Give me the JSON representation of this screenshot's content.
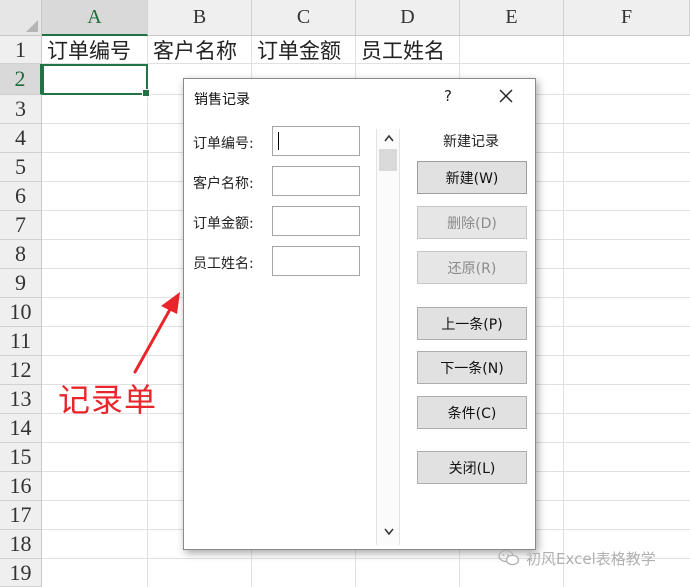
{
  "columns": [
    "A",
    "B",
    "C",
    "D",
    "E",
    "F"
  ],
  "rows": [
    "1",
    "2",
    "3",
    "4",
    "5",
    "6",
    "7",
    "8",
    "9",
    "10",
    "11",
    "12",
    "13",
    "14",
    "15",
    "16",
    "17",
    "18",
    "19"
  ],
  "header_cells": [
    "订单编号",
    "客户名称",
    "订单金额",
    "员工姓名"
  ],
  "active_column": "A",
  "active_row": "2",
  "annotation": {
    "label": "记录单",
    "color": "#e8262b"
  },
  "dialog": {
    "title": "销售记录",
    "help": "?",
    "status": "新建记录",
    "fields": [
      {
        "label": "订单编号:",
        "value": ""
      },
      {
        "label": "客户名称:",
        "value": ""
      },
      {
        "label": "订单金额:",
        "value": ""
      },
      {
        "label": "员工姓名:",
        "value": ""
      }
    ],
    "buttons": {
      "new": "新建(W)",
      "delete": "删除(D)",
      "restore": "还原(R)",
      "prev": "上一条(P)",
      "next": "下一条(N)",
      "criteria": "条件(C)",
      "close": "关闭(L)"
    }
  },
  "watermark": "初风Excel表格教学",
  "colors": {
    "excel_green": "#217346",
    "annotation_red": "#e8262b"
  }
}
